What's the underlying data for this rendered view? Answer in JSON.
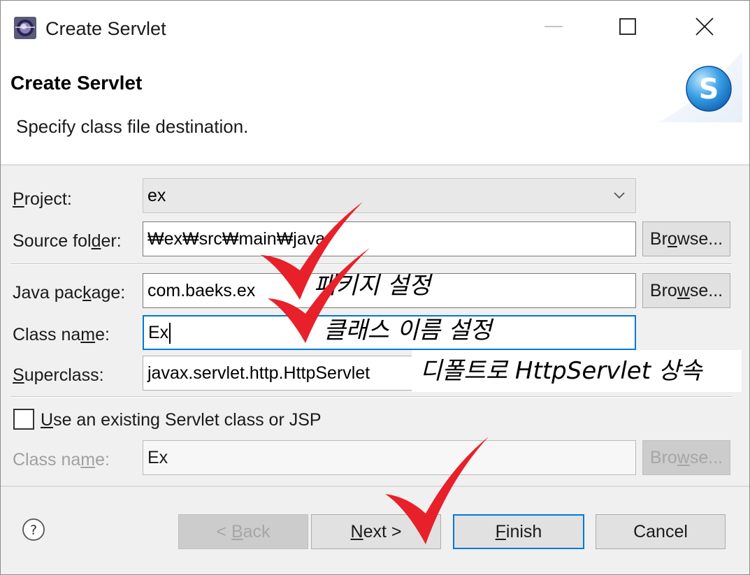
{
  "window": {
    "title": "Create Servlet",
    "controls": [
      "minimize",
      "maximize",
      "close"
    ]
  },
  "header": {
    "title": "Create Servlet",
    "message": "Specify class file destination.",
    "banner_icon": "servlet-s-logo"
  },
  "form": {
    "project": {
      "mnemonic": "P",
      "label_rest": "roject:",
      "value": "ex"
    },
    "source_folder": {
      "label_pre": "Source fol",
      "mnemonic": "d",
      "label_post": "er:",
      "value": "₩ex₩src₩main₩java",
      "browse_pre": "Br",
      "browse_mn": "o",
      "browse_post": "wse..."
    },
    "java_package": {
      "label_pre": "Java pac",
      "mnemonic": "k",
      "label_post": "age:",
      "value": "com.baeks.ex",
      "browse_pre": "Bro",
      "browse_mn": "w",
      "browse_post": "se..."
    },
    "class_name": {
      "label_pre": "Class na",
      "mnemonic": "m",
      "label_post": "e:",
      "value": "Ex"
    },
    "superclass": {
      "mnemonic": "S",
      "label_rest": "uperclass:",
      "value": "javax.servlet.http.HttpServlet"
    },
    "use_existing": {
      "checked": false,
      "mnemonic": "U",
      "label_rest": "se an existing Servlet class or JSP"
    },
    "existing_class_name": {
      "label_pre": "Class na",
      "mnemonic": "m",
      "label_post": "e:",
      "value": "Ex",
      "browse_pre": "Bro",
      "browse_mn": "w",
      "browse_post": "se..."
    }
  },
  "annotations": {
    "package": "패키지 설정",
    "class_name": "클래스 이름 설정",
    "superclass": "디폴트로 HttpServlet 상속"
  },
  "footer": {
    "help_icon": "help-icon",
    "back": {
      "pre": "< ",
      "mn": "B",
      "post": "ack"
    },
    "next": {
      "mn": "N",
      "post": "ext >"
    },
    "finish": {
      "mn": "F",
      "post": "inish"
    },
    "cancel": "Cancel"
  },
  "colors": {
    "accent": "#0078d7",
    "checkmark": "#e8202a",
    "dialog_bg": "#f0f0f0"
  }
}
